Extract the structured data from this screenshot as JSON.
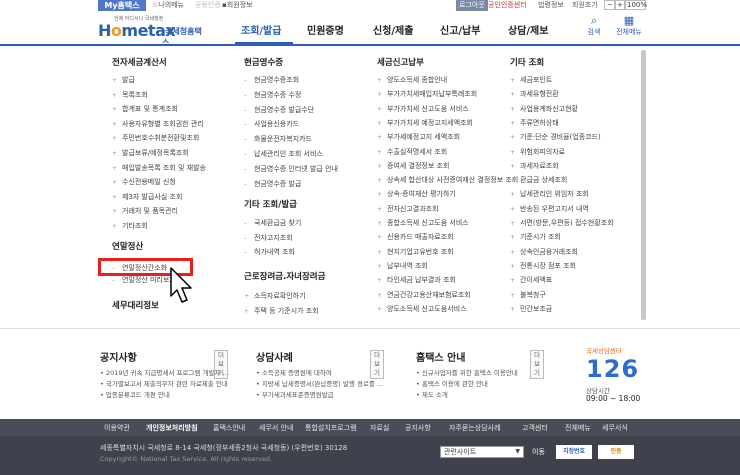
{
  "topbar": {
    "myhome": "My홈택스",
    "util_items": [
      "나의메뉴",
      "공동인증",
      "회원정보"
    ],
    "login": "로그아웃",
    "cert_center": "공인인증센터",
    "user_name": "법령정보",
    "site_map": "회원조기",
    "font_label": "100%"
  },
  "logo": {
    "tiny": "언제 어디서나 국세행정",
    "brand_pre": "H",
    "brand_o": "o",
    "brand_post": "metax",
    "sub": ".국세청홈택스"
  },
  "gnb": {
    "items": [
      "조회/발급",
      "민원증명",
      "신청/제출",
      "신고/납부",
      "상담/제보"
    ],
    "search_label": "검색",
    "allmenu_label": "전체메뉴"
  },
  "mega": {
    "col1": {
      "title": "전자세금계산서",
      "items": [
        "발급",
        "목록조회",
        "합계표 및 통계조회",
        "사용자유형별 조회권한 관리",
        "주민번호수취분전환및조회",
        "발급보류/예정목록조회",
        "매입발송목록 조회 및 재발송",
        "수신전용메일 신청",
        "제3자 발급사실 조회",
        "거래처 및 품목관리",
        "기타조회"
      ],
      "title2": "연말정산",
      "items2": [
        "연말정산간소화",
        "연말정산 미리보기"
      ],
      "title3": "세무대리정보"
    },
    "col2": {
      "title": "현금영수증",
      "items": [
        "현금영수증조회",
        "현금영수증 수정",
        "현금영수증 발급수단",
        "사업용신용카드",
        "화물운전자복지카드",
        "납세관리인 조회 서비스",
        "현금영수증 인터넷 발급 안내",
        "현금영수증 발급"
      ],
      "title2": "기타 조회/발급",
      "items2": [
        "국세환급금 찾기",
        "전자고지조회",
        "허가내역 조회"
      ],
      "title3": "근로장려금.자녀장려금",
      "items3": [
        "소득자료확인하기",
        "주택 등 기준시가 조회"
      ]
    },
    "col3": {
      "title": "세금신고납부",
      "items": [
        "양도소득세 종합안내",
        "부가가치세매입자납부특례조회",
        "부가가치세 신고도움 서비스",
        "부가가치세 예정고지세액조회",
        "부가세예정고지 세액조회",
        "수출실적명세서 조회",
        "증여세 결정정보 조회",
        "상속세 합산대상 사전증여재산 결정정보 조회",
        "상속·증여재산 평가하기",
        "전자신고결과조회",
        "종합소득세 신고도움 서비스",
        "신용카드 매출자료조회",
        "현지기업고유번호 조회",
        "납부내역 조회",
        "타인세금 납부결과 조회",
        "연금건강고용산재보험료조회",
        "양도소득세 신고도움서비스"
      ]
    },
    "col4": {
      "title": "기타 조회",
      "items": [
        "세금포인트",
        "과세유형전환",
        "사업용계좌신고현황",
        "주류면허상태",
        "기준·단순 경비율(업종코드)",
        "위험회피의자료",
        "과세자료조회",
        "환급금 상세조회",
        "납세관리인 위임자 조회",
        "반송된 우편고지서 내역",
        "서면(방문,우편등) 접수현황조회",
        "기준시가 조회",
        "상속인금융거래조회",
        "전통시장 점포 조회",
        "간이세액표",
        "불복청구",
        "민간보조금"
      ]
    }
  },
  "lower": {
    "notice": {
      "title": "공지사항",
      "more": "더보기",
      "lines": [
        "2019년 귀속 지급명세서 프로그램 개발자 …",
        "국가별보고서 제출의무자 관련 자료제출 안내",
        "업종분류코드 개편 안내"
      ]
    },
    "cases": {
      "title": "상담사례",
      "more": "더보기",
      "lines": [
        "소득공제 증명원에 대하여",
        "지방세 납세증명서(완납증명) 발행 경로를 …",
        "부가세과세표준증명원발급"
      ]
    },
    "guide": {
      "title": "홈택스 안내",
      "more": "더보기",
      "lines": [
        "신규사업자를 위한 홈택스 이용안내",
        "홈택스 이용에 관한 안내",
        "제도 소개"
      ]
    },
    "callcenter": {
      "t1": "국세상담센터",
      "num": "126",
      "t2": "상담시간",
      "t3": "09:00 ~ 18:00"
    }
  },
  "footer": {
    "links": [
      "이용약관",
      "개인정보처리방침",
      "홈택스안내",
      "세무서 안내",
      "통합설치프로그램",
      "자료실",
      "공지사항",
      "자주묻는상담사례",
      "고객센터",
      "전체메뉴",
      "세무서식"
    ],
    "address": "세종특별자치시 국세청로 8-14 국세청(정부세종2청사 국세청동) (우편번호) 30128",
    "copyright": "Copyright© National Tax Service. All rights reserved.",
    "related_site": "관련사이트",
    "go": "이동",
    "cert1": "지정번호",
    "cert2": "인증"
  }
}
